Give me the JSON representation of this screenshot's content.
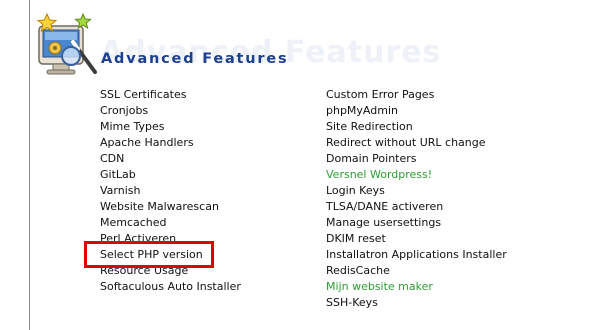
{
  "section": {
    "title": "Advanced Features",
    "watermark": "Advanced Features",
    "icon": "advanced-features-icon"
  },
  "features_left": [
    {
      "label": "SSL Certificates"
    },
    {
      "label": "Cronjobs"
    },
    {
      "label": "Mime Types"
    },
    {
      "label": "Apache Handlers"
    },
    {
      "label": "CDN"
    },
    {
      "label": "GitLab"
    },
    {
      "label": "Varnish"
    },
    {
      "label": "Website Malwarescan"
    },
    {
      "label": "Memcached"
    },
    {
      "label": "Perl Activeren"
    },
    {
      "label": "Select PHP version"
    },
    {
      "label": "Resource Usage"
    },
    {
      "label": "Softaculous Auto Installer"
    }
  ],
  "features_right": [
    {
      "label": "Custom Error Pages"
    },
    {
      "label": "phpMyAdmin"
    },
    {
      "label": "Site Redirection"
    },
    {
      "label": "Redirect without URL change"
    },
    {
      "label": "Domain Pointers"
    },
    {
      "label": "Versnel Wordpress!"
    },
    {
      "label": "Login Keys"
    },
    {
      "label": "TLSA/DANE activeren"
    },
    {
      "label": "Manage usersettings"
    },
    {
      "label": "DKIM reset"
    },
    {
      "label": "Installatron Applications Installer"
    },
    {
      "label": "RedisCache"
    },
    {
      "label": "Mijn website maker"
    },
    {
      "label": "SSH-Keys"
    }
  ],
  "colors": {
    "title": "#1c3f8f",
    "link": "#111111",
    "highlight_link": "#2e9e33",
    "callout_border": "#e00000"
  }
}
